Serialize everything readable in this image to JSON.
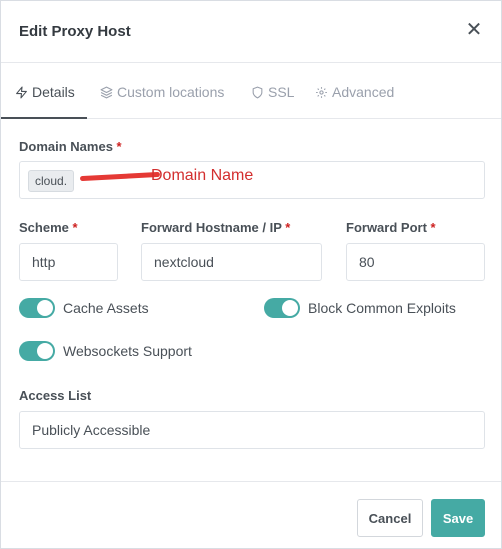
{
  "modal": {
    "title": "Edit Proxy Host",
    "close_symbol": "✕"
  },
  "tabs": [
    {
      "label": "Details",
      "icon": "lightning-icon",
      "active": true
    },
    {
      "label": "Custom locations",
      "icon": "layers-icon",
      "active": false
    },
    {
      "label": "SSL",
      "icon": "shield-icon",
      "active": false
    },
    {
      "label": "Advanced",
      "icon": "gear-icon",
      "active": false
    }
  ],
  "form": {
    "domain_names": {
      "label": "Domain Names",
      "required_mark": "*",
      "chip_value": "cloud.",
      "annotation": "Domain Name"
    },
    "scheme": {
      "label": "Scheme",
      "required_mark": "*",
      "value": "http"
    },
    "forward_host": {
      "label": "Forward Hostname / IP",
      "required_mark": "*",
      "value": "nextcloud"
    },
    "forward_port": {
      "label": "Forward Port",
      "required_mark": "*",
      "value": "80"
    },
    "toggles": {
      "cache_assets": {
        "label": "Cache Assets",
        "on": true
      },
      "block_exploits": {
        "label": "Block Common Exploits",
        "on": true
      },
      "websockets": {
        "label": "Websockets Support",
        "on": true
      }
    },
    "access_list": {
      "label": "Access List",
      "value": "Publicly Accessible"
    }
  },
  "footer": {
    "cancel_label": "Cancel",
    "save_label": "Save"
  },
  "colors": {
    "accent": "#45aaa4",
    "required": "#cd201f",
    "annotation": "#d32f2f"
  }
}
